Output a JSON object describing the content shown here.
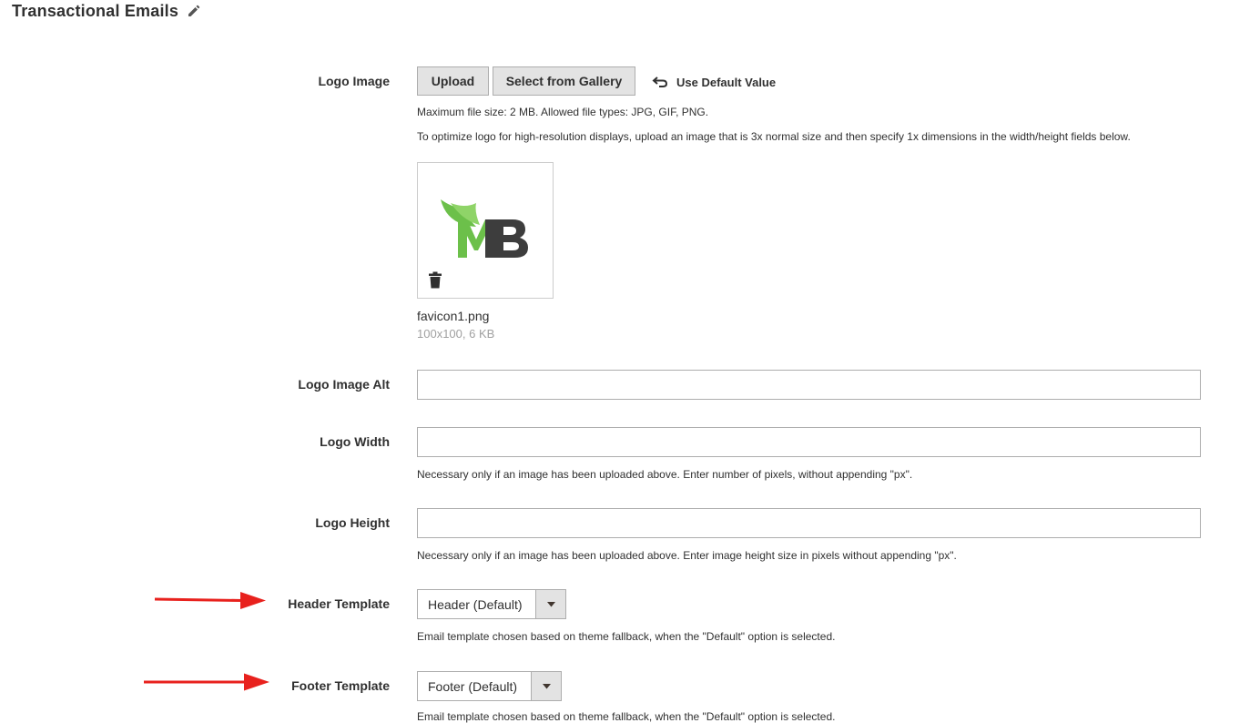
{
  "section": {
    "title": "Transactional Emails",
    "edit_icon": "pencil-icon"
  },
  "logo_image": {
    "label": "Logo Image",
    "upload_label": "Upload",
    "gallery_label": "Select from Gallery",
    "use_default_label": "Use Default Value",
    "note_size": "Maximum file size: 2 MB. Allowed file types: JPG, GIF, PNG.",
    "note_optimize": "To optimize logo for high-resolution displays, upload an image that is 3x normal size and then specify 1x dimensions in the width/height fields below.",
    "file_name": "favicon1.png",
    "file_meta": "100x100, 6 KB",
    "preview_logo_text": "MB",
    "colors": {
      "logo_green": "#6cc04a",
      "logo_dark": "#3d3d3d"
    }
  },
  "logo_alt": {
    "label": "Logo Image Alt",
    "value": ""
  },
  "logo_width": {
    "label": "Logo Width",
    "value": "",
    "note": "Necessary only if an image has been uploaded above. Enter number of pixels, without appending \"px\"."
  },
  "logo_height": {
    "label": "Logo Height",
    "value": "",
    "note": "Necessary only if an image has been uploaded above. Enter image height size in pixels without appending \"px\"."
  },
  "header_template": {
    "label": "Header Template",
    "selected": "Header (Default)",
    "note": "Email template chosen based on theme fallback, when the \"Default\" option is selected."
  },
  "footer_template": {
    "label": "Footer Template",
    "selected": "Footer (Default)",
    "note": "Email template chosen based on theme fallback, when the \"Default\" option is selected."
  },
  "annotation_color": "#e8211d"
}
